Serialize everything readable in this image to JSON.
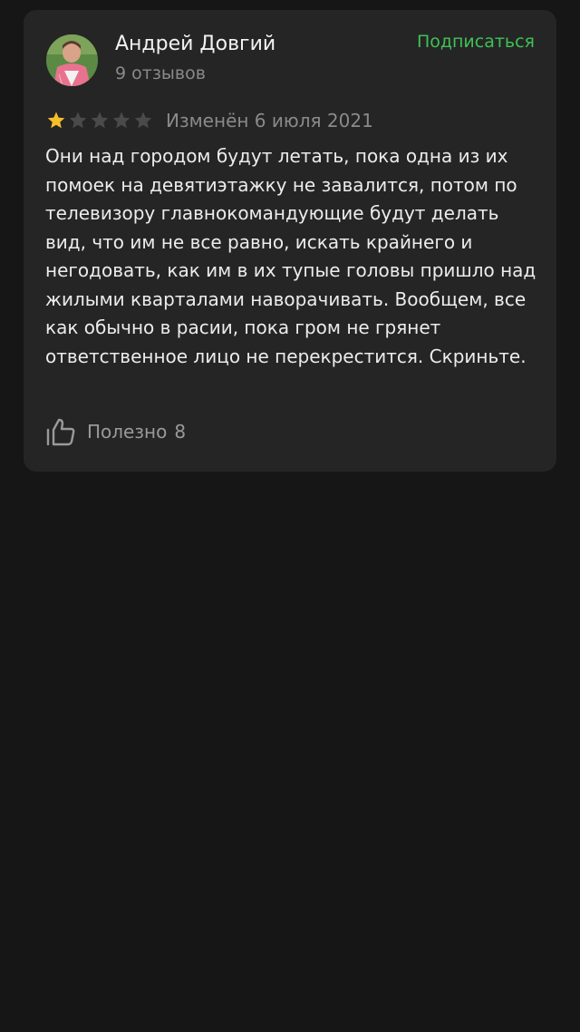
{
  "review": {
    "author": "Андрей Довгий",
    "reviews_count": "9 отзывов",
    "subscribe_label": "Подписаться",
    "rating": 1,
    "max_rating": 5,
    "edited_label": "Изменён 6 июля 2021",
    "text": "Они над городом будут летать, пока одна из их помоек на девятиэтажку не завалится, потом по телевизору главнокомандующие будут делать вид, что им не все равно, искать крайнего и негодовать, как им в их тупые головы пришло над жилыми кварталами наворачивать. Вообщем, все как обычно в расии, пока гром не грянет ответственное лицо не перекрестится. Скриньте.",
    "useful_label": "Полезно",
    "useful_count": "8"
  },
  "colors": {
    "background": "#161616",
    "card": "#252525",
    "accent_green": "#3fc155",
    "star_filled": "#f5bf2b",
    "star_empty": "#4a4a4a"
  },
  "icons": {
    "avatar": "user-avatar-photo",
    "star": "star-icon",
    "useful": "thumbs-up-icon"
  }
}
